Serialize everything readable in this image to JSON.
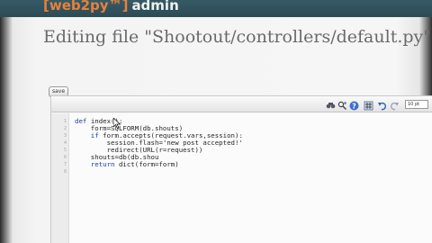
{
  "header": {
    "brand_web2py": "[web2py™]",
    "brand_admin": "admin"
  },
  "page": {
    "title": "Editing file \"Shootout/controllers/default.py\""
  },
  "editor": {
    "save_label": "save",
    "font_size": "10 pt",
    "toolbar_icons": [
      "search-icon",
      "find-replace-icon",
      "help-icon",
      "wrap-icon",
      "undo-icon",
      "redo-icon",
      "toggle-editor-icon"
    ],
    "line_numbers": [
      "1",
      "2",
      "3",
      "4",
      "5",
      "6",
      "7",
      "8"
    ],
    "lines": [
      {
        "kw": "def ",
        "text": "index():"
      },
      {
        "kw": "",
        "text": "    form=SQLFORM(db.shouts)"
      },
      {
        "kw": "    if ",
        "text": "form.accepts(request.vars,session):"
      },
      {
        "kw": "",
        "text": "        session.flash='new post accepted!'"
      },
      {
        "kw": "",
        "text": "        redirect(URL(r=request))"
      },
      {
        "kw": "",
        "text": "    shouts=db(db.shou"
      },
      {
        "kw": "    return ",
        "text": "dict(form=form)"
      },
      {
        "kw": "",
        "text": ""
      }
    ]
  },
  "colors": {
    "header_bg": "#2d4b55",
    "brand_accent": "#e9803a",
    "keyword": "#1d3f9e"
  }
}
